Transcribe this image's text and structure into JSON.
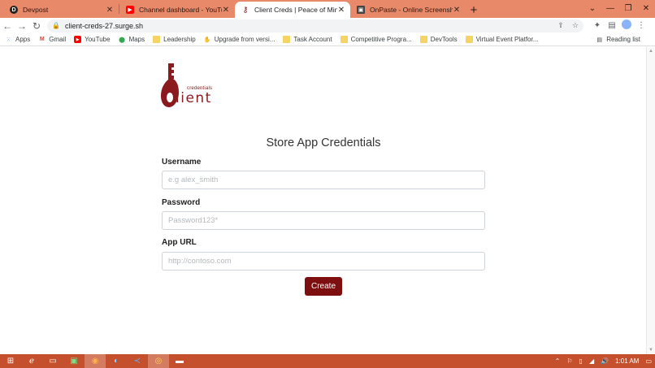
{
  "browser": {
    "tabs": [
      {
        "title": "Devpost",
        "favicon": "devpost-icon",
        "favicon_color": "#222222",
        "active": false
      },
      {
        "title": "Channel dashboard - YouTube Stu",
        "favicon": "youtube-icon",
        "favicon_color": "#ff0000",
        "active": false
      },
      {
        "title": "Client Creds | Peace of Mind for y",
        "favicon": "key-icon",
        "favicon_color": "#8b1a1e",
        "active": true
      },
      {
        "title": "OnPaste - Online Screenshot and",
        "favicon": "onpaste-icon",
        "favicon_color": "#444444",
        "active": false
      }
    ],
    "new_tab": "+",
    "url": "client-creds-27.surge.sh",
    "bookmarks": [
      {
        "label": "Apps",
        "icon": "apps-grid-icon"
      },
      {
        "label": "Gmail",
        "icon": "gmail-icon"
      },
      {
        "label": "YouTube",
        "icon": "youtube-icon"
      },
      {
        "label": "Maps",
        "icon": "maps-pin-icon"
      },
      {
        "label": "Leadership",
        "icon": "folder-icon"
      },
      {
        "label": "Upgrade from versi...",
        "icon": "upgrade-icon"
      },
      {
        "label": "Task Account",
        "icon": "folder-icon"
      },
      {
        "label": "Competitive Progra...",
        "icon": "folder-icon"
      },
      {
        "label": "DevTools",
        "icon": "folder-icon"
      },
      {
        "label": "Virtual Event Platfor...",
        "icon": "folder-icon"
      }
    ],
    "reading_list": "Reading list",
    "chrome_color": "#e8896a"
  },
  "app": {
    "logo": {
      "small_text": "credentials",
      "big_text": "lient"
    },
    "heading": "Store App Credentials",
    "form": {
      "username_label": "Username",
      "username_placeholder": "e.g alex_smith",
      "password_label": "Password",
      "password_placeholder": "Password123*",
      "url_label": "App URL",
      "url_placeholder": "http://contoso.com",
      "submit_label": "Create"
    },
    "accent_color": "#7d0f11"
  },
  "taskbar": {
    "time": "1:01 AM",
    "color": "#c4502e"
  }
}
